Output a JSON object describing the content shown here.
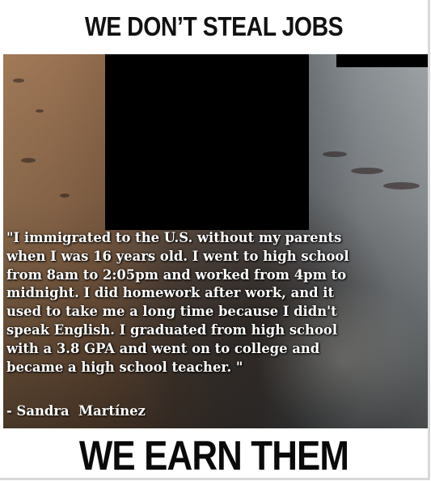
{
  "header": {
    "title": "WE DON’T STEAL JOBS"
  },
  "quote": {
    "lines": [
      "\"I immigrated to the U.S. without my parents",
      "when I was 16 years old. I went to high school",
      "from 8am to 2:05pm and worked from 4pm to",
      "midnight. I did homework after work, and it",
      "used to take me a long time because I didn't",
      "speak English. I graduated from high school",
      "with a 3.8 GPA and went on to college and",
      "became a high school teacher. \""
    ],
    "attribution": "- Sandra  Martínez"
  },
  "footer": {
    "title": "WE EARN THEM"
  }
}
